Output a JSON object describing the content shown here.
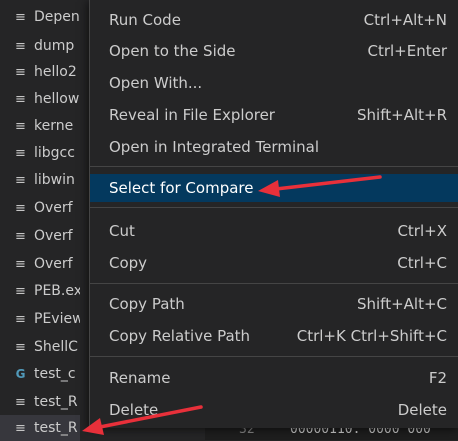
{
  "explorer": {
    "files": [
      {
        "name": "Depen",
        "icon": "lines-file-icon"
      },
      {
        "name": "dump",
        "icon": "lines-file-icon"
      },
      {
        "name": "hello2",
        "icon": "lines-file-icon"
      },
      {
        "name": "hellow",
        "icon": "lines-file-icon"
      },
      {
        "name": "kerne",
        "icon": "lines-file-icon"
      },
      {
        "name": "libgcc",
        "icon": "lines-file-icon"
      },
      {
        "name": "libwin",
        "icon": "lines-file-icon"
      },
      {
        "name": "Overf",
        "icon": "lines-file-icon"
      },
      {
        "name": "Overf",
        "icon": "lines-file-icon"
      },
      {
        "name": "Overf",
        "icon": "lines-file-icon"
      },
      {
        "name": "PEB.ex",
        "icon": "lines-file-icon"
      },
      {
        "name": "PEview",
        "icon": "lines-file-icon"
      },
      {
        "name": "ShellC",
        "icon": "lines-file-icon"
      },
      {
        "name": "test_c",
        "icon": "cpp-file-icon"
      },
      {
        "name": "test_R",
        "icon": "lines-file-icon"
      },
      {
        "name": "test_R",
        "icon": "lines-file-icon"
      }
    ]
  },
  "context_menu": {
    "items": [
      {
        "label": "Run Code",
        "shortcut": "Ctrl+Alt+N"
      },
      {
        "label": "Open to the Side",
        "shortcut": "Ctrl+Enter"
      },
      {
        "label": "Open With...",
        "shortcut": ""
      },
      {
        "label": "Reveal in File Explorer",
        "shortcut": "Shift+Alt+R"
      },
      {
        "label": "Open in Integrated Terminal",
        "shortcut": ""
      },
      {
        "label": "Select for Compare",
        "shortcut": ""
      },
      {
        "label": "Cut",
        "shortcut": "Ctrl+X"
      },
      {
        "label": "Copy",
        "shortcut": "Ctrl+C"
      },
      {
        "label": "Copy Path",
        "shortcut": "Shift+Alt+C"
      },
      {
        "label": "Copy Relative Path",
        "shortcut": "Ctrl+K Ctrl+Shift+C"
      },
      {
        "label": "Rename",
        "shortcut": "F2"
      },
      {
        "label": "Delete",
        "shortcut": "Delete"
      }
    ]
  },
  "editor": {
    "line_number": "32",
    "code_text": "00000110: 0000 000"
  },
  "colors": {
    "menu_background": "#252526",
    "highlight": "#04395e",
    "arrow": "#e8303a",
    "text": "#cccccc"
  }
}
